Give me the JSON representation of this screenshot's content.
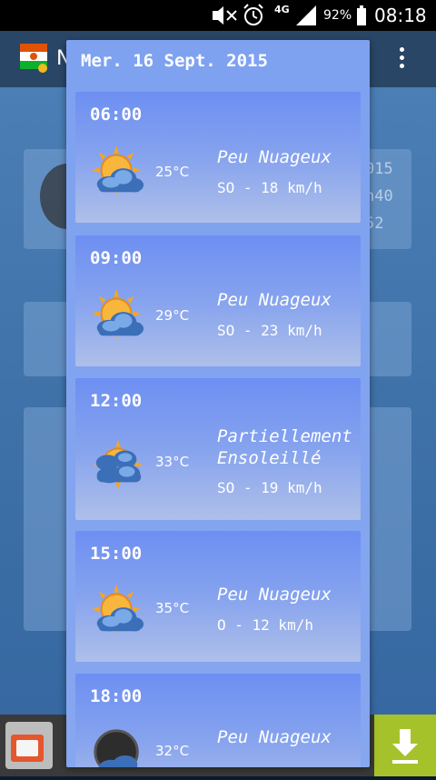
{
  "status_bar": {
    "icons": [
      "mute-icon",
      "alarm-icon",
      "network-4g-icon",
      "signal-icon",
      "battery-icon"
    ],
    "network": "4G",
    "battery": "92%",
    "time": "08:18"
  },
  "app_bar": {
    "title": "N",
    "menu_icon": "overflow-menu-icon"
  },
  "background": {
    "right_texts": [
      "015",
      "n40",
      "52"
    ]
  },
  "dialog": {
    "title": "Mer. 16 Sept. 2015",
    "forecasts": [
      {
        "time": "06:00",
        "temp": "25°C",
        "condition_lines": [
          "Peu Nuageux"
        ],
        "wind": "SO - 18 km/h",
        "icon": "partly-cloudy-icon"
      },
      {
        "time": "09:00",
        "temp": "29°C",
        "condition_lines": [
          "Peu Nuageux"
        ],
        "wind": "SO - 23 km/h",
        "icon": "partly-cloudy-icon"
      },
      {
        "time": "12:00",
        "temp": "33°C",
        "condition_lines": [
          "Partiellement",
          "Ensoleillé"
        ],
        "wind": "SO - 19 km/h",
        "icon": "partly-sunny-icon"
      },
      {
        "time": "15:00",
        "temp": "35°C",
        "condition_lines": [
          "Peu Nuageux"
        ],
        "wind": "O - 12 km/h",
        "icon": "partly-cloudy-icon"
      },
      {
        "time": "18:00",
        "temp": "32°C",
        "condition_lines": [
          "Peu Nuageux"
        ],
        "wind": "",
        "icon": "partly-cloudy-evening-icon"
      }
    ]
  },
  "colors": {
    "dialog_bg": "#7ea2f0",
    "card_top": "#6d8ff2",
    "card_bottom": "#aebfe9",
    "status_bar": "#000000",
    "ad_download_bg": "#a6c22a"
  }
}
